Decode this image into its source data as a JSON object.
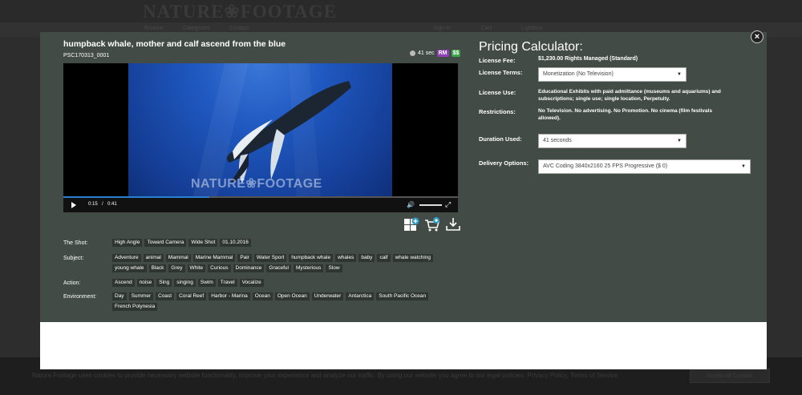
{
  "background": {
    "logo": "NATURE❀FOOTAGE",
    "nav_items": [
      "Browse",
      "Categories",
      "Contact"
    ],
    "nav_right": [
      "Sign In",
      "Cart",
      "Lightbox"
    ],
    "cookie_text": "Nature Footage uses cookies to provide necessary website functionality, improve your experience and analyze our traffic. By using our website you agree to our legal policies: Privacy Policy, Terms of Service",
    "cookie_button": "Accept All Cookies"
  },
  "modal": {
    "close_label": "×",
    "clip": {
      "title": "humpback whale, mother and calf ascend from the blue",
      "id": "PSC170313_0001",
      "duration": "41 sec",
      "rm_badge": "RM",
      "price_badge": "$$"
    },
    "player": {
      "watermark": "NATURE❀FOOTAGE",
      "current_time": "0:15",
      "separator": "/",
      "total_time": "0:41",
      "progress": 0.37
    },
    "icons": [
      "lightbox-add-icon",
      "cart-add-icon",
      "download-icon"
    ],
    "tags": [
      {
        "label": "The Shot:",
        "items": [
          "High Angle",
          "Toward Camera",
          "Wide Shot",
          "01.10.2016"
        ]
      },
      {
        "label": "Subject:",
        "items": [
          "Adventure",
          "animal",
          "Mammal",
          "Marine Mammal",
          "Pair",
          "Water Sport",
          "humpback whale",
          "whales",
          "baby",
          "calf",
          "whale watching",
          "young whale",
          "Black",
          "Grey",
          "White",
          "Curious",
          "Dominance",
          "Graceful",
          "Mysterious",
          "Slow"
        ]
      },
      {
        "label": "Action:",
        "items": [
          "Ascend",
          "noise",
          "Sing",
          "singing",
          "Swim",
          "Travel",
          "Vocalize"
        ]
      },
      {
        "label": "Environment:",
        "items": [
          "Day",
          "Summer",
          "Coast",
          "Coral Reef",
          "Harbor - Marina",
          "Ocean",
          "Open Ocean",
          "Underwater",
          "Antarctica",
          "South Pacific Ocean",
          "French Polynesia"
        ]
      }
    ],
    "pricing": {
      "title": "Pricing Calculator:",
      "license_fee_label": "License Fee:",
      "license_fee_value": "$1,230.00 Rights Managed (Standard)",
      "license_terms_label": "License Terms:",
      "license_terms_value": "Monetization (No Television)",
      "license_use_label": "License Use:",
      "license_use_value": "Educational Exhibits with paid admittance (museums and aquariums) and subscriptions; single use; single location, Perpetuity.",
      "restrictions_label": "Restrictions:",
      "restrictions_value": "No Television. No advertising. No Promotion. No cinema (film festivals allowed).",
      "duration_label": "Duration Used:",
      "duration_value": "41 seconds",
      "delivery_label": "Delivery Options:",
      "delivery_value": "AVC Coding 3840x2160 25 FPS Progressive ($ 0)"
    }
  }
}
